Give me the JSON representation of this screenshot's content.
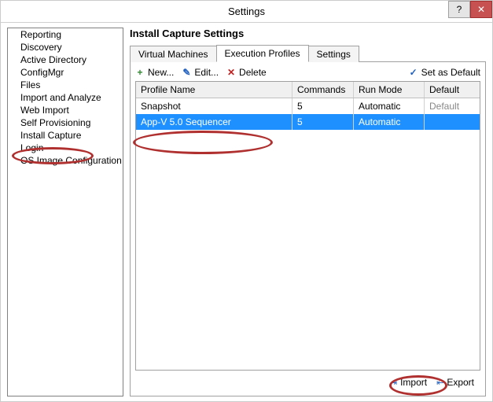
{
  "window": {
    "title": "Settings",
    "help_label": "?",
    "close_label": "✕"
  },
  "sidebar": {
    "items": [
      {
        "label": "Reporting"
      },
      {
        "label": "Discovery"
      },
      {
        "label": "Active Directory"
      },
      {
        "label": "ConfigMgr"
      },
      {
        "label": "Files"
      },
      {
        "label": "Import and Analyze"
      },
      {
        "label": "Web Import"
      },
      {
        "label": "Self Provisioning"
      },
      {
        "label": "Install Capture"
      },
      {
        "label": "Login"
      },
      {
        "label": "OS Image Configuration"
      }
    ]
  },
  "main": {
    "heading": "Install Capture Settings",
    "tabs": [
      {
        "label": "Virtual Machines"
      },
      {
        "label": "Execution Profiles"
      },
      {
        "label": "Settings"
      }
    ],
    "toolbar": {
      "new_label": "New...",
      "edit_label": "Edit...",
      "delete_label": "Delete",
      "default_label": "Set as Default"
    },
    "grid": {
      "headers": {
        "name": "Profile Name",
        "commands": "Commands",
        "mode": "Run Mode",
        "default": "Default"
      },
      "rows": [
        {
          "name": "Snapshot",
          "commands": "5",
          "mode": "Automatic",
          "default": "Default"
        },
        {
          "name": "App-V 5.0 Sequencer",
          "commands": "5",
          "mode": "Automatic",
          "default": ""
        }
      ]
    },
    "footer": {
      "import_label": "Import",
      "export_label": "Export"
    }
  },
  "icons": {
    "plus": "+",
    "pencil": "✎",
    "cross": "✕",
    "check": "✓",
    "arrow_in": "⇥",
    "arrow_out": "⇤"
  }
}
